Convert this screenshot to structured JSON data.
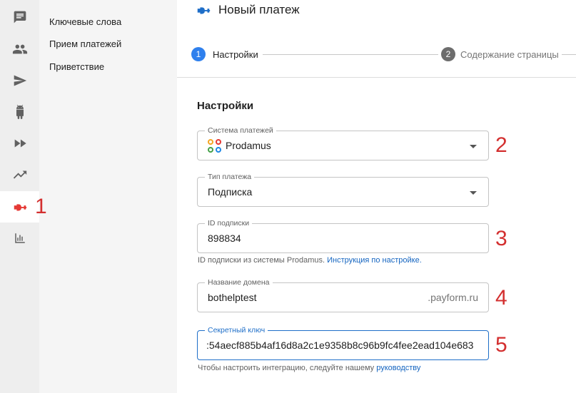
{
  "rail": {
    "items": [
      {
        "icon": "chat-icon"
      },
      {
        "icon": "people-icon"
      },
      {
        "icon": "send-icon"
      },
      {
        "icon": "android-icon"
      },
      {
        "icon": "double-chevron-icon"
      },
      {
        "icon": "trending-up-icon"
      },
      {
        "icon": "plug-icon",
        "active": true
      },
      {
        "icon": "bar-chart-icon"
      }
    ]
  },
  "submenu": {
    "items": [
      {
        "label": "Ключевые слова"
      },
      {
        "label": "Прием платежей"
      },
      {
        "label": "Приветствие"
      }
    ]
  },
  "header": {
    "title": "Новый платеж"
  },
  "stepper": {
    "steps": [
      {
        "number": "1",
        "label": "Настройки",
        "active": true
      },
      {
        "number": "2",
        "label": "Содержание страницы",
        "active": false
      }
    ]
  },
  "form": {
    "section_title": "Настройки",
    "payment_system": {
      "legend": "Система платежей",
      "value": "Prodamus"
    },
    "payment_type": {
      "legend": "Тип платежа",
      "value": "Подписка"
    },
    "subscription_id": {
      "legend": "ID подписки",
      "value": "898834",
      "helper_text": "ID подписки из системы Prodamus.",
      "helper_link": "Инструкция по настройке."
    },
    "domain": {
      "legend": "Название домена",
      "value": "bothelptest",
      "suffix": ".payform.ru"
    },
    "secret_key": {
      "legend": "Секретный ключ",
      "value": ":54aecf885b4af16d8a2c1e9358b8c96b9fc4fee2ead104e683",
      "helper_text": "Чтобы настроить интеграцию, следуйте нашему",
      "helper_link": "руководству"
    }
  },
  "annotations": {
    "markers": [
      "1",
      "2",
      "3",
      "4",
      "5"
    ],
    "color": "#d32f2f"
  },
  "colors": {
    "accent": "#1e6ec8",
    "step_active": "#2f80ed",
    "step_inactive": "#6d6d6d",
    "plug_active": "#e53935"
  }
}
